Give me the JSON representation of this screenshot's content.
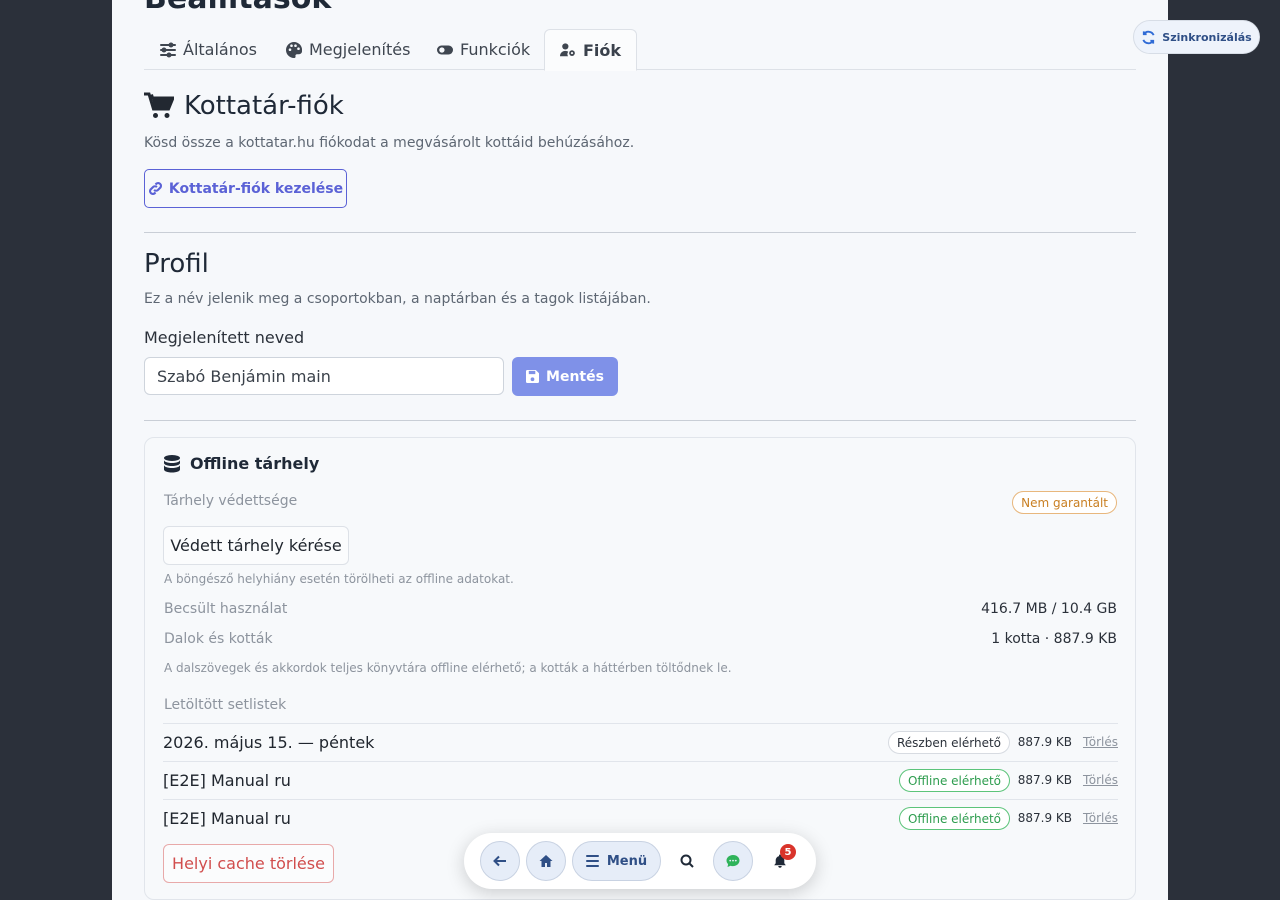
{
  "page": {
    "title": "Beállítások"
  },
  "tabs": [
    {
      "label": "Általános",
      "icon": "sliders-icon"
    },
    {
      "label": "Megjelenítés",
      "icon": "palette-icon"
    },
    {
      "label": "Funkciók",
      "icon": "toggle-icon"
    },
    {
      "label": "Fiók",
      "icon": "user-gear-icon",
      "active": true
    }
  ],
  "kottatar": {
    "title": "Kottatár-fiók",
    "description": "Kösd össze a kottatar.hu fiókodat a megvásárolt kottáid behúzásához.",
    "manage_button": "Kottatár-fiók kezelése"
  },
  "profile": {
    "title": "Profil",
    "description": "Ez a név jelenik meg a csoportokban, a naptárban és a tagok listájában.",
    "name_label": "Megjelenített neved",
    "name_value": "Szabó Benjámin main",
    "save_button": "Mentés"
  },
  "storage": {
    "title": "Offline tárhely",
    "protection_label": "Tárhely védettsége",
    "protection_badge": "Nem garantált",
    "request_button": "Védett tárhely kérése",
    "protection_note": "A böngésző helyhiány esetén törölheti az offline adatokat.",
    "usage_label": "Becsült használat",
    "usage_value": "416.7 MB / 10.4 GB",
    "songs_label": "Dalok és kották",
    "songs_value": "1 kotta · 887.9 KB",
    "library_note": "A dalszövegek és akkordok teljes könyvtára offline elérhető; a kották a háttérben töltődnek le.",
    "setlists_label": "Letöltött setlistek",
    "setlists": [
      {
        "name": "2026. május 15. — péntek",
        "status": "Részben elérhető",
        "size": "887.9 KB",
        "delete": "Törlés"
      },
      {
        "name": "[E2E] Manual ru",
        "status": "Offline elérhető",
        "size": "887.9 KB",
        "delete": "Törlés"
      },
      {
        "name": "[E2E] Manual ru",
        "status": "Offline elérhető",
        "size": "887.9 KB",
        "delete": "Törlés"
      }
    ],
    "clear_cache_button": "Helyi cache törlése"
  },
  "sync": {
    "label": "Szinkronizálás"
  },
  "bottom_nav": {
    "menu_label": "Menü",
    "notification_count": "5"
  },
  "colors": {
    "accent": "#5b62d6",
    "save_bg": "#7f91e8",
    "offline_green": "#2e9d4f",
    "warn_orange": "#c97f22",
    "danger": "#d14d4d",
    "notif_red": "#d9342b"
  }
}
